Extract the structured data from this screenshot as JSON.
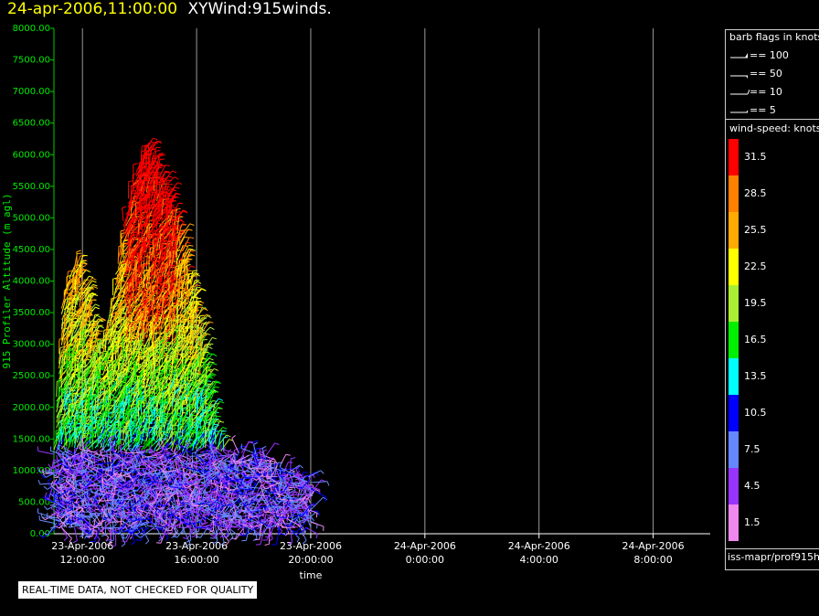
{
  "title": {
    "timestamp": "24-apr-2006,11:00:00",
    "name": "XYWind:915winds."
  },
  "chart_data": {
    "type": "scatter",
    "description_type": "wind-barb time-height plot",
    "ylabel": "915 Profiler Altitude (m agl)",
    "xlabel": "time",
    "ylim": [
      0,
      8000
    ],
    "yticks": [
      "0.00",
      "500.00",
      "1000.00",
      "1500.00",
      "2000.00",
      "2500.00",
      "3000.00",
      "3500.00",
      "4000.00",
      "4500.00",
      "5000.00",
      "5500.00",
      "6000.00",
      "6500.00",
      "7000.00",
      "7500.00",
      "8000.00"
    ],
    "xticks": [
      {
        "date": "23-Apr-2006",
        "time": "12:00:00"
      },
      {
        "date": "23-Apr-2006",
        "time": "16:00:00"
      },
      {
        "date": "23-Apr-2006",
        "time": "20:00:00"
      },
      {
        "date": "24-Apr-2006",
        "time": "0:00:00"
      },
      {
        "date": "24-Apr-2006",
        "time": "4:00:00"
      },
      {
        "date": "24-Apr-2006",
        "time": "8:00:00"
      }
    ],
    "xlim_hours": [
      -1,
      22
    ],
    "grid": "vertical",
    "envelope": [
      {
        "x": -1.0,
        "top": 1500
      },
      {
        "x": -0.7,
        "top": 3800
      },
      {
        "x": -0.2,
        "top": 4300
      },
      {
        "x": 0.2,
        "top": 3600
      },
      {
        "x": 0.6,
        "top": 2800
      },
      {
        "x": 1.0,
        "top": 3600
      },
      {
        "x": 1.4,
        "top": 4900
      },
      {
        "x": 1.8,
        "top": 5700
      },
      {
        "x": 2.2,
        "top": 6100
      },
      {
        "x": 2.6,
        "top": 5800
      },
      {
        "x": 3.0,
        "top": 5300
      },
      {
        "x": 3.4,
        "top": 4700
      },
      {
        "x": 3.8,
        "top": 3900
      },
      {
        "x": 4.2,
        "top": 3000
      },
      {
        "x": 4.6,
        "top": 1500
      },
      {
        "x": 5.0,
        "top": 1300
      },
      {
        "x": 5.6,
        "top": 1300
      },
      {
        "x": 6.2,
        "top": 1300
      },
      {
        "x": 6.8,
        "top": 1100
      },
      {
        "x": 7.4,
        "top": 1000
      },
      {
        "x": 8.0,
        "top": 900
      }
    ]
  },
  "legend": {
    "barb_title": "barb flags in knots",
    "barbs": [
      "== 100",
      "== 50",
      "== 10",
      "== 5"
    ],
    "colorbar_title": "wind-speed: knots",
    "colorbar": [
      {
        "label": "31.5",
        "color": "#ff0000"
      },
      {
        "label": "28.5",
        "color": "#ff7f00"
      },
      {
        "label": "25.5",
        "color": "#ffaa00"
      },
      {
        "label": "22.5",
        "color": "#ffff00"
      },
      {
        "label": "19.5",
        "color": "#aaee33"
      },
      {
        "label": "16.5",
        "color": "#00ee00"
      },
      {
        "label": "13.5",
        "color": "#00ffff"
      },
      {
        "label": "10.5",
        "color": "#0000ff"
      },
      {
        "label": "7.5",
        "color": "#6688ff"
      },
      {
        "label": "4.5",
        "color": "#9933ff"
      },
      {
        "label": "1.5",
        "color": "#ee88ee"
      }
    ],
    "source": "iss-mapr/prof915h"
  },
  "disclaimer": "REAL-TIME DATA, NOT CHECKED FOR QUALITY"
}
